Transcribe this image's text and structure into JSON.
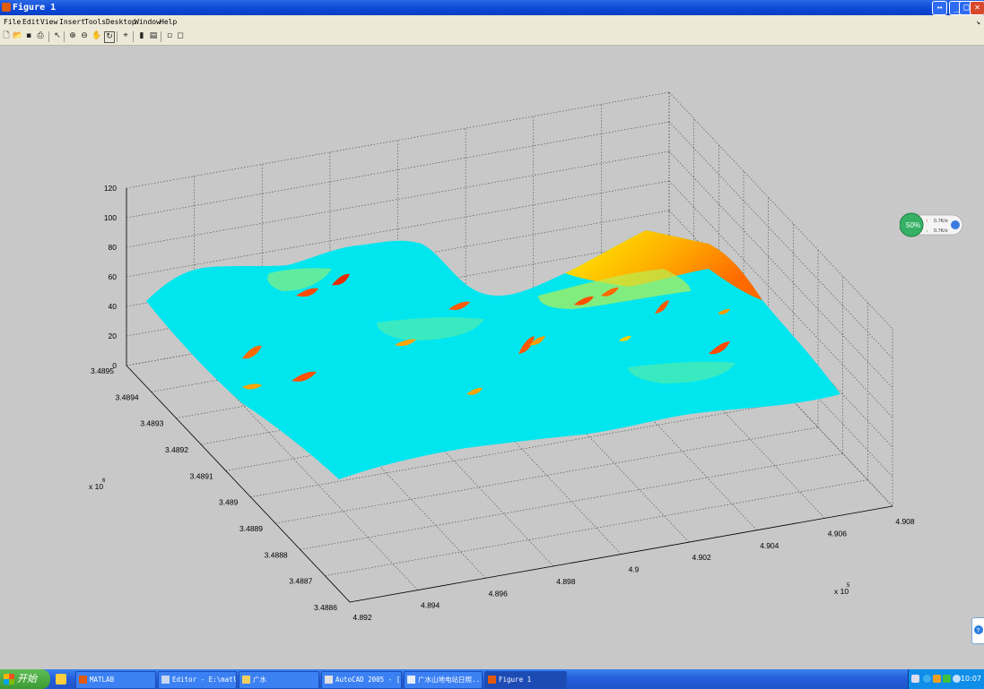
{
  "window": {
    "title": "Figure 1"
  },
  "menu": {
    "items": [
      "File",
      "Edit",
      "View",
      "Insert",
      "Tools",
      "Desktop",
      "Window",
      "Help"
    ]
  },
  "toolbar": {
    "icons": [
      "new-file-icon",
      "open-folder-icon",
      "save-icon",
      "print-icon",
      "pointer-icon",
      "zoom-in-icon",
      "zoom-out-icon",
      "pan-hand-icon",
      "rotate-3d-icon",
      "data-cursor-icon",
      "colorbar-icon",
      "legend-icon",
      "hide-plot-tools-icon",
      "show-plot-tools-icon"
    ]
  },
  "chart_data": {
    "type": "surface3d",
    "z_ticks": [
      "0",
      "20",
      "40",
      "60",
      "80",
      "100",
      "120"
    ],
    "y_ticks": [
      "3.4886",
      "3.4887",
      "3.4888",
      "3.4889",
      "3.489",
      "3.4891",
      "3.4892",
      "3.4893",
      "3.4894",
      "3.4895"
    ],
    "x_ticks": [
      "4.892",
      "4.894",
      "4.896",
      "4.898",
      "4.9",
      "4.902",
      "4.904",
      "4.906",
      "4.908"
    ],
    "y_exponent": "x 10",
    "y_exponent_power": "6",
    "x_exponent": "x 10",
    "x_exponent_power": "5",
    "zlim": [
      0,
      120
    ],
    "xlim": [
      489200,
      490800
    ],
    "ylim": [
      3488600,
      3489500
    ],
    "grid": true,
    "colormap": [
      "#00e6ef",
      "#fff200",
      "#ff8a00",
      "#e21a00"
    ]
  },
  "net_widget": {
    "percent": "50%",
    "upload": "0.7K/s",
    "download": "0.7K/s"
  },
  "taskbar": {
    "start": "开始",
    "tasks": [
      "MATLAB",
      "Editor - E:\\matl...",
      "广水",
      "AutoCAD 2005 - [...",
      "广水山地电站日照...",
      "Figure 1"
    ],
    "clock": "10:07"
  }
}
